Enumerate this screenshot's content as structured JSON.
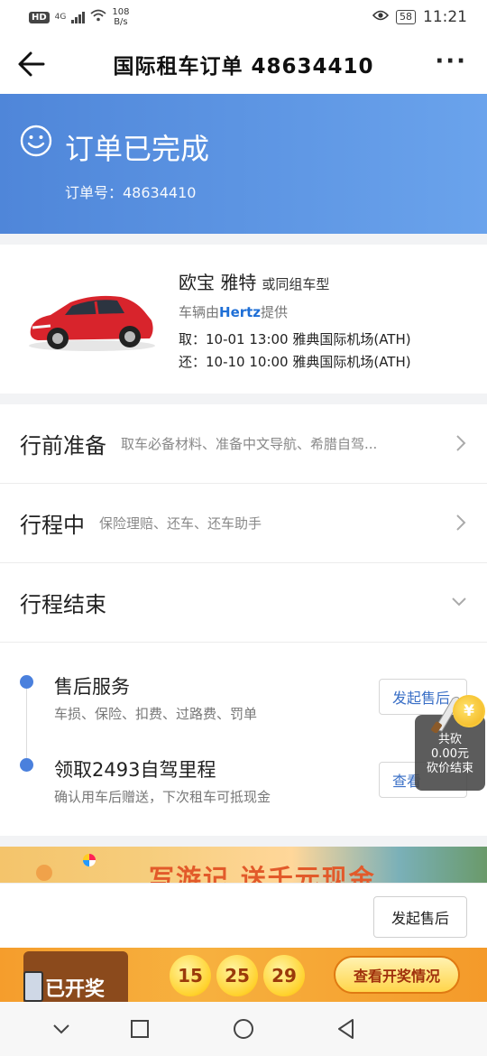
{
  "status_bar": {
    "hd": "HD",
    "network": "4G",
    "speed_value": "108",
    "speed_unit": "B/s",
    "battery": "58",
    "time": "11:21"
  },
  "nav": {
    "title": "国际租车订单 48634410",
    "more": "···",
    "back_icon": "arrow-left-icon"
  },
  "order_status": {
    "title": "订单已完成",
    "order_no": "订单号：48634410",
    "icon": "smiley-icon"
  },
  "car": {
    "name": "欧宝 雅特",
    "name_suffix": "或同组车型",
    "provider_prefix": "车辆由",
    "provider": "Hertz",
    "provider_suffix": "提供",
    "pickup": "取：10-01 13:00 雅典国际机场(ATH)",
    "return": "还：10-10 10:00 雅典国际机场(ATH)",
    "color": "#d8242c"
  },
  "sections": [
    {
      "title": "行前准备",
      "desc": "取车必备材料、准备中文导航、希腊自驾...",
      "icon": "chevron-right-icon"
    },
    {
      "title": "行程中",
      "desc": "保险理赔、还车、还车助手",
      "icon": "chevron-right-icon"
    },
    {
      "title": "行程结束",
      "desc": "",
      "icon": "chevron-down-icon"
    }
  ],
  "timeline": [
    {
      "title": "售后服务",
      "desc": "车损、保险、扣费、过路费、罚单",
      "button": "发起售后"
    },
    {
      "title": "领取2493自驾里程",
      "desc": "确认用车后赠送，下次租车可抵现金",
      "button": "查看"
    }
  ],
  "bargain": {
    "coin": "¥",
    "line1": "共砍",
    "line2": "0.00元",
    "line3": "砍价结束"
  },
  "ad": {
    "text": "写游记 送千元现金"
  },
  "action": {
    "button": "发起售后"
  },
  "lottery": {
    "status": "已开奖",
    "numbers": [
      "15",
      "25",
      "29"
    ],
    "button": "查看开奖情况"
  },
  "colors": {
    "accent": "#4a80dd",
    "banner_start": "#4f86d9",
    "banner_end": "#6aa3ec",
    "link": "#3a6fc6"
  }
}
